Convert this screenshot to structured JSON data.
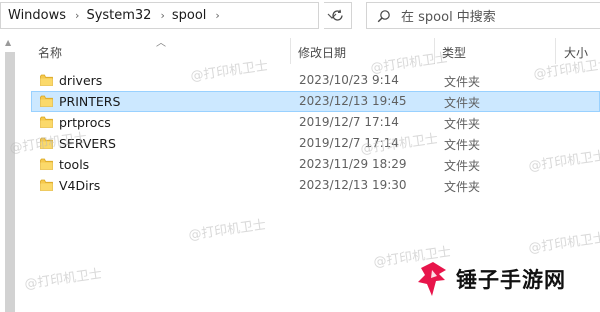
{
  "address_bar": {
    "crumbs": [
      "Windows",
      "System32",
      "spool"
    ],
    "separator": "›",
    "dropdown_icon": "chevron-down-icon",
    "refresh_icon": "refresh-icon"
  },
  "search": {
    "placeholder": "在 spool 中搜索",
    "icon": "search-icon"
  },
  "columns": [
    {
      "key": "name",
      "label": "名称"
    },
    {
      "key": "date",
      "label": "修改日期"
    },
    {
      "key": "type",
      "label": "类型"
    },
    {
      "key": "size",
      "label": "大小"
    }
  ],
  "files": [
    {
      "name": "drivers",
      "date": "2023/10/23 9:14",
      "type": "文件夹",
      "selected": false
    },
    {
      "name": "PRINTERS",
      "date": "2023/12/13 19:45",
      "type": "文件夹",
      "selected": true
    },
    {
      "name": "prtprocs",
      "date": "2019/12/7 17:14",
      "type": "文件夹",
      "selected": false
    },
    {
      "name": "SERVERS",
      "date": "2019/12/7 17:14",
      "type": "文件夹",
      "selected": false
    },
    {
      "name": "tools",
      "date": "2023/11/29 18:29",
      "type": "文件夹",
      "selected": false
    },
    {
      "name": "V4Dirs",
      "date": "2023/12/13 19:30",
      "type": "文件夹",
      "selected": false
    }
  ],
  "watermark": {
    "text": "@打印机卫士"
  },
  "logo": {
    "text": "锤子手游网"
  },
  "colors": {
    "selection_bg": "#cce8ff",
    "selection_border": "#99d1ff",
    "folder_yellow": "#f6c94d"
  }
}
